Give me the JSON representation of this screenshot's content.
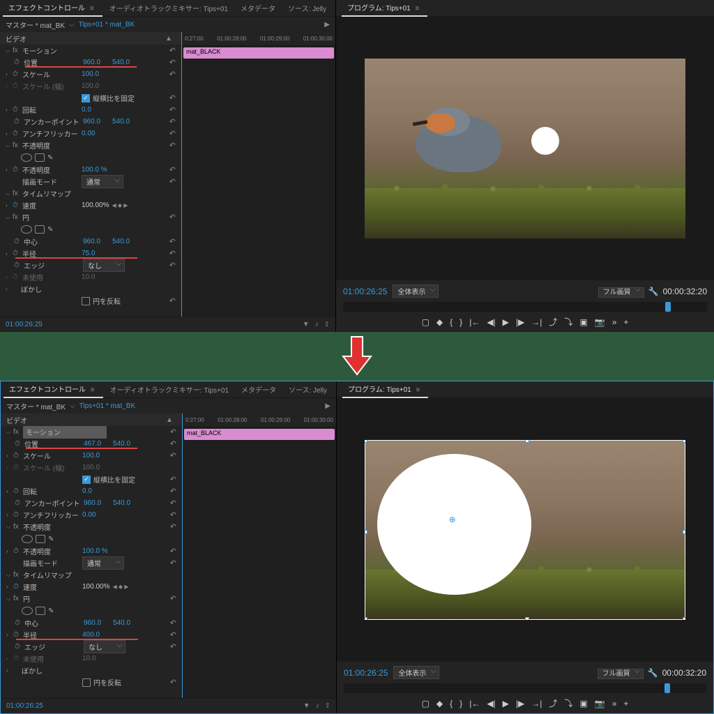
{
  "tabs": {
    "effect_controls": "エフェクトコントロール",
    "audio_mixer": "オーディオトラックミキサー: Tips+01",
    "metadata": "メタデータ",
    "source": "ソース: Jelly"
  },
  "breadcrumb": {
    "master": "マスター * mat_BK",
    "clip": "Tips+01 * mat_BK"
  },
  "sections": {
    "video": "ビデオ",
    "motion": "モーション",
    "opacity": "不透明度",
    "time_remap": "タイムリマップ",
    "circle": "円"
  },
  "props": {
    "position": "位置",
    "scale": "スケール",
    "scale_w": "スケール (幅)",
    "lock_aspect": "縦横比を固定",
    "rotation": "回転",
    "anchor": "アンカーポイント",
    "antiflicker": "アンチフリッカー",
    "opacity": "不透明度",
    "blend": "描画モード",
    "speed": "速度",
    "center": "中心",
    "radius": "半径",
    "edge": "エッジ",
    "unused": "未使用",
    "feather": "ぼかし",
    "invert": "円を反転"
  },
  "values_top": {
    "pos_x": "960.0",
    "pos_y": "540.0",
    "scale": "100.0",
    "scale_w": "100.0",
    "rotation": "0.0",
    "anchor_x": "960.0",
    "anchor_y": "540.0",
    "antiflicker": "0.00",
    "opacity": "100.0 %",
    "blend": "通常",
    "speed": "100.00%",
    "center_x": "960.0",
    "center_y": "540.0",
    "radius": "75.0",
    "edge": "なし",
    "unused": "10.0"
  },
  "values_bottom": {
    "pos_x": "467.0",
    "pos_y": "540.0",
    "scale": "100.0",
    "scale_w": "100.0",
    "rotation": "0.0",
    "anchor_x": "960.0",
    "anchor_y": "540.0",
    "antiflicker": "0.00",
    "opacity": "100.0 %",
    "blend": "通常",
    "speed": "100.00%",
    "center_x": "960.0",
    "center_y": "540.0",
    "radius": "400.0",
    "edge": "なし",
    "unused": "10.0"
  },
  "timeline": {
    "clip_name": "mat_BLACK",
    "ticks": [
      "0:27:00",
      "01:00:28:00",
      "01:00:29:00",
      "01:00:30:00"
    ],
    "current_tc": "01:00:26:25"
  },
  "program": {
    "tab": "プログラム: Tips+01",
    "tc": "01:00:26:25",
    "zoom": "全体表示",
    "quality": "フル画質",
    "duration": "00:00:32:20"
  },
  "fx_label": "fx"
}
